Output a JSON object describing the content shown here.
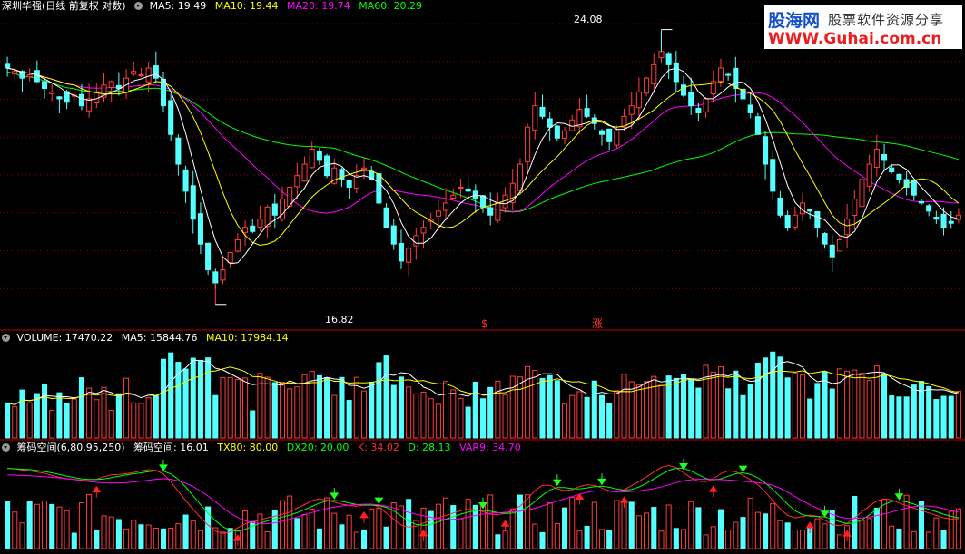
{
  "price_panel": {
    "title": "深圳华强(日线 前复权 对数)",
    "ma_labels": [
      {
        "text": "MA5: 19.49",
        "color": "#ffffff"
      },
      {
        "text": "MA10: 19.44",
        "color": "#ffff00"
      },
      {
        "text": "MA20: 19.74",
        "color": "#ff00ff"
      },
      {
        "text": "MA60: 20.29",
        "color": "#00ff00"
      }
    ],
    "high_marker": "24.08",
    "low_marker": "16.82",
    "event_marks": [
      "$",
      "涨"
    ]
  },
  "volume_panel": {
    "labels": [
      {
        "text": "VOLUME: 17470.22",
        "color": "#ffffff"
      },
      {
        "text": "MA5: 15844.76",
        "color": "#ffffff"
      },
      {
        "text": "MA10: 17984.14",
        "color": "#ffff00"
      }
    ]
  },
  "indicator_panel": {
    "labels": [
      {
        "text": "筹码空间(6,80,95,250)",
        "color": "#ffffff"
      },
      {
        "text": "筹码空间: 16.01",
        "color": "#ffffff"
      },
      {
        "text": "TX80: 80.00",
        "color": "#ffff00"
      },
      {
        "text": "DX20: 20.00",
        "color": "#00ff00"
      },
      {
        "text": "K: 34.02",
        "color": "#ff3030"
      },
      {
        "text": "D: 28.13",
        "color": "#00ff00"
      },
      {
        "text": "VAR9: 34.70",
        "color": "#ff00ff"
      }
    ]
  },
  "watermark": {
    "brand": "股海网",
    "slogan": "股票软件资源分享",
    "url": "WWW.Guhai.com.cn"
  },
  "colors": {
    "up": "#ff3c3c",
    "down": "#54ffff",
    "ma5": "#ffffff",
    "ma10": "#ffff00",
    "ma20": "#ff00ff",
    "ma60": "#00ff00",
    "grid": "#8b0000"
  },
  "chart_data": {
    "type": "candlestick",
    "scale": "log",
    "ylim": [
      16.5,
      24.5
    ],
    "close": [
      22.9,
      22.8,
      22.6,
      22.7,
      22.5,
      22.3,
      22.2,
      22.0,
      21.9,
      22.1,
      21.8,
      22.0,
      22.2,
      22.4,
      22.5,
      22.3,
      22.6,
      22.8,
      22.7,
      22.9,
      22.6,
      21.8,
      21.0,
      20.2,
      19.5,
      18.8,
      18.2,
      17.6,
      17.3,
      17.6,
      18.0,
      18.3,
      18.6,
      18.5,
      18.8,
      19.1,
      18.9,
      19.3,
      19.6,
      19.9,
      20.2,
      20.6,
      20.3,
      19.9,
      20.1,
      19.8,
      19.6,
      19.9,
      20.1,
      19.8,
      19.2,
      18.6,
      18.2,
      17.8,
      18.1,
      18.4,
      18.6,
      18.8,
      19.0,
      19.2,
      19.4,
      19.6,
      19.5,
      19.3,
      19.1,
      18.9,
      19.2,
      19.4,
      19.7,
      20.2,
      21.2,
      21.8,
      21.5,
      21.2,
      20.9,
      21.1,
      21.4,
      21.7,
      21.5,
      21.3,
      21.0,
      20.8,
      21.1,
      21.5,
      21.8,
      22.2,
      22.6,
      23.0,
      23.4,
      23.0,
      22.5,
      22.1,
      21.8,
      21.6,
      22.0,
      22.5,
      22.9,
      22.7,
      22.3,
      22.0,
      21.6,
      21.0,
      20.2,
      19.5,
      18.9,
      18.6,
      18.9,
      19.2,
      19.0,
      18.6,
      18.2,
      17.9,
      18.3,
      18.8,
      19.3,
      19.8,
      20.2,
      20.6,
      20.3,
      20.0,
      19.8,
      19.6,
      19.4,
      19.2,
      19.0,
      18.8,
      18.6,
      18.7,
      18.9
    ],
    "high_point": 24.08,
    "low_point": 16.82
  }
}
